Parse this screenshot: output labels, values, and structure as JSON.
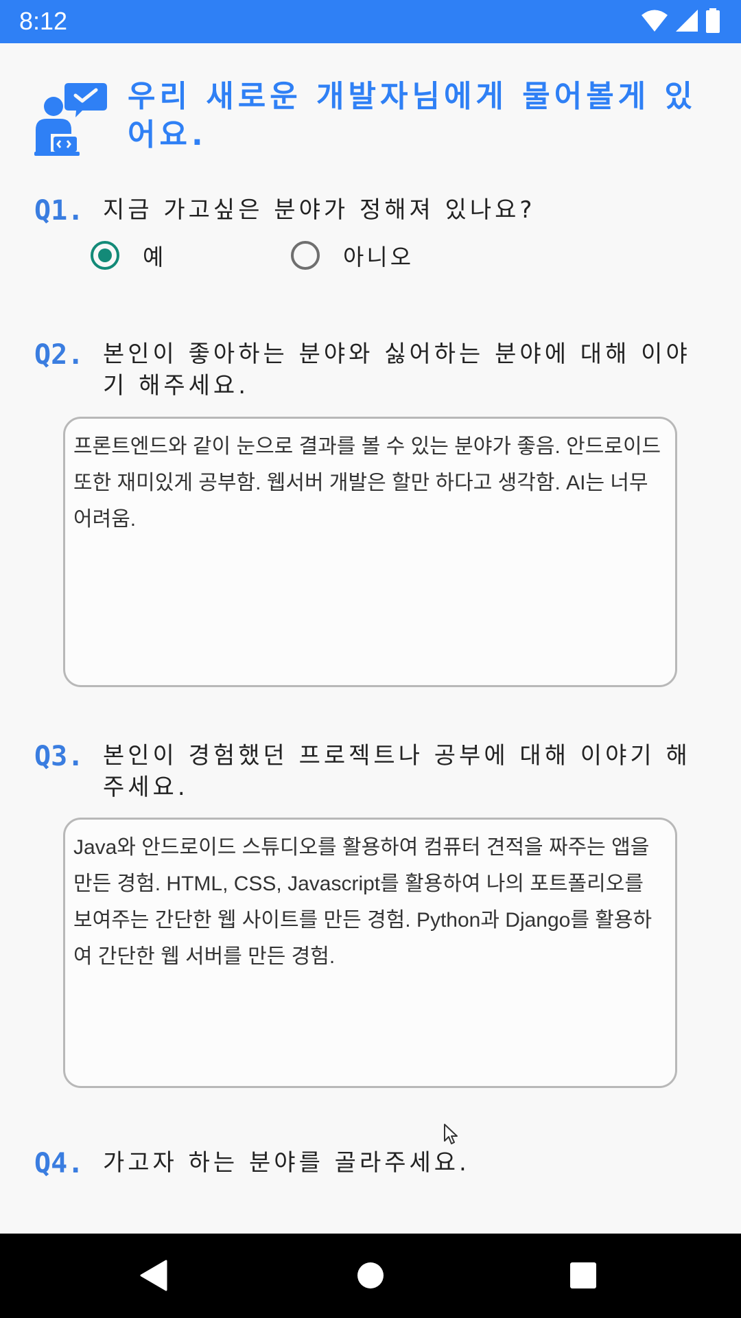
{
  "status_bar": {
    "time": "8:12",
    "icons": [
      "wifi-icon",
      "signal-icon",
      "battery-icon"
    ],
    "color": "#2f80f5"
  },
  "header": {
    "icon": "developer-chat-icon",
    "title": "우리 새로운 개발자님에게 물어볼게 있어요."
  },
  "questions": [
    {
      "number": "Q1.",
      "text": "지금 가고싶은 분야가 정해져 있나요?",
      "options": [
        {
          "label": "예",
          "checked": true
        },
        {
          "label": "아니오",
          "checked": false
        }
      ]
    },
    {
      "number": "Q2.",
      "text": "본인이 좋아하는 분야와 싫어하는 분야에 대해 이야기 해주세요.",
      "answer": "프론트엔드와 같이 눈으로 결과를 볼 수 있는 분야가 좋음. 안드로이드 또한 재미있게 공부함. 웹서버 개발은 할만 하다고 생각함. AI는 너무 어려움."
    },
    {
      "number": "Q3.",
      "text": "본인이 경험했던 프로젝트나 공부에 대해 이야기 해주세요.",
      "answer": "Java와 안드로이드 스튜디오를 활용하여 컴퓨터 견적을 짜주는 앱을 만든 경험. HTML, CSS, Javascript를 활용하여 나의 포트폴리오를 보여주는 간단한 웹 사이트를 만든 경험. Python과 Django를 활용하여 간단한 웹 서버를 만든 경험."
    },
    {
      "number": "Q4.",
      "text": "가고자 하는 분야를 골라주세요."
    }
  ],
  "nav_bar": {
    "buttons": [
      "back-icon",
      "home-icon",
      "recents-icon"
    ]
  },
  "colors": {
    "accent": "#2f80f5",
    "radio_checked": "#138a78"
  }
}
